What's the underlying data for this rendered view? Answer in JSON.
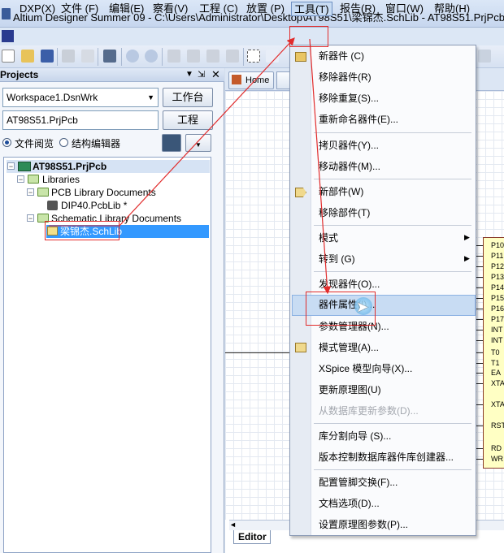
{
  "titlebar": {
    "title": "Altium Designer Summer 09 - C:\\Users\\Administrator\\Desktop\\AT98S51\\梁锦杰.SchLib - AT98S51.PrjPcb."
  },
  "menubar": {
    "items": [
      {
        "id": "dxp",
        "label": "DXP(X)"
      },
      {
        "id": "file",
        "label": "文件 (F)"
      },
      {
        "id": "edit",
        "label": "编辑(E)"
      },
      {
        "id": "view",
        "label": "察看(V)"
      },
      {
        "id": "project",
        "label": "工程 (C)"
      },
      {
        "id": "place",
        "label": "放置 (P)"
      },
      {
        "id": "tools",
        "label": "工具(T)"
      },
      {
        "id": "reports",
        "label": "报告(R)"
      },
      {
        "id": "window",
        "label": "窗口(W)"
      },
      {
        "id": "help",
        "label": "帮助(H)"
      }
    ]
  },
  "panel": {
    "title": "Projects",
    "workspace_value": "Workspace1.DsnWrk",
    "workspace_button": "工作台",
    "project_value": "AT98S51.PrjPcb",
    "project_button": "工程",
    "radio_file_view": "文件阅览",
    "radio_struct_editor": "结构编辑器"
  },
  "tree": {
    "project": "AT98S51.PrjPcb",
    "libraries": "Libraries",
    "pcb_docs": "PCB Library Documents",
    "pcb_file": "DIP40.PcbLib *",
    "sch_docs": "Schematic Library Documents",
    "sch_file": "梁锦杰.SchLib"
  },
  "doc": {
    "home_tab": "Home",
    "editor_tab": "Editor",
    "pins": [
      "P10",
      "P11",
      "P12",
      "P13",
      "P14",
      "P15",
      "P16",
      "P17",
      "INT",
      "INT",
      "T0",
      "T1",
      "EA",
      "XTA",
      "",
      "XTA",
      "",
      "RST",
      "",
      "RD",
      "WR"
    ]
  },
  "tools_menu": {
    "items": [
      {
        "label": "新器件 (C)",
        "enabled": true
      },
      {
        "label": "移除器件(R)",
        "enabled": true
      },
      {
        "label": "移除重复(S)...",
        "enabled": true
      },
      {
        "label": "重新命名器件(E)...",
        "enabled": true
      },
      {
        "label": "拷贝器件(Y)...",
        "enabled": true
      },
      {
        "label": "移动器件(M)...",
        "enabled": true
      },
      {
        "label": "新部件(W)",
        "enabled": true
      },
      {
        "label": "移除部件(T)",
        "enabled": true
      },
      {
        "label": "模式",
        "enabled": true
      },
      {
        "label": "转到 (G)",
        "enabled": true
      },
      {
        "label": "发现器件(O)...",
        "enabled": true
      },
      {
        "label": "器件属性(I)...",
        "enabled": true
      },
      {
        "label": "参数管理器(N)...",
        "enabled": true
      },
      {
        "label": "模式管理(A)...",
        "enabled": true
      },
      {
        "label": "XSpice 模型向导(X)...",
        "enabled": true
      },
      {
        "label": "更新原理图(U)",
        "enabled": true
      },
      {
        "label": "从数据库更新参数(D)...",
        "enabled": false
      },
      {
        "label": "库分割向导 (S)...",
        "enabled": true
      },
      {
        "label": "版本控制数据库器件库创建器...",
        "enabled": true
      },
      {
        "label": "配置管脚交换(F)...",
        "enabled": true
      },
      {
        "label": "文档选项(D)...",
        "enabled": true
      },
      {
        "label": "设置原理图参数(P)...",
        "enabled": true
      }
    ],
    "highlighted": "器件属性(I)..."
  },
  "colors": {
    "annotation": "#e12c2c",
    "menu_highlight": "#c8dcf3"
  }
}
